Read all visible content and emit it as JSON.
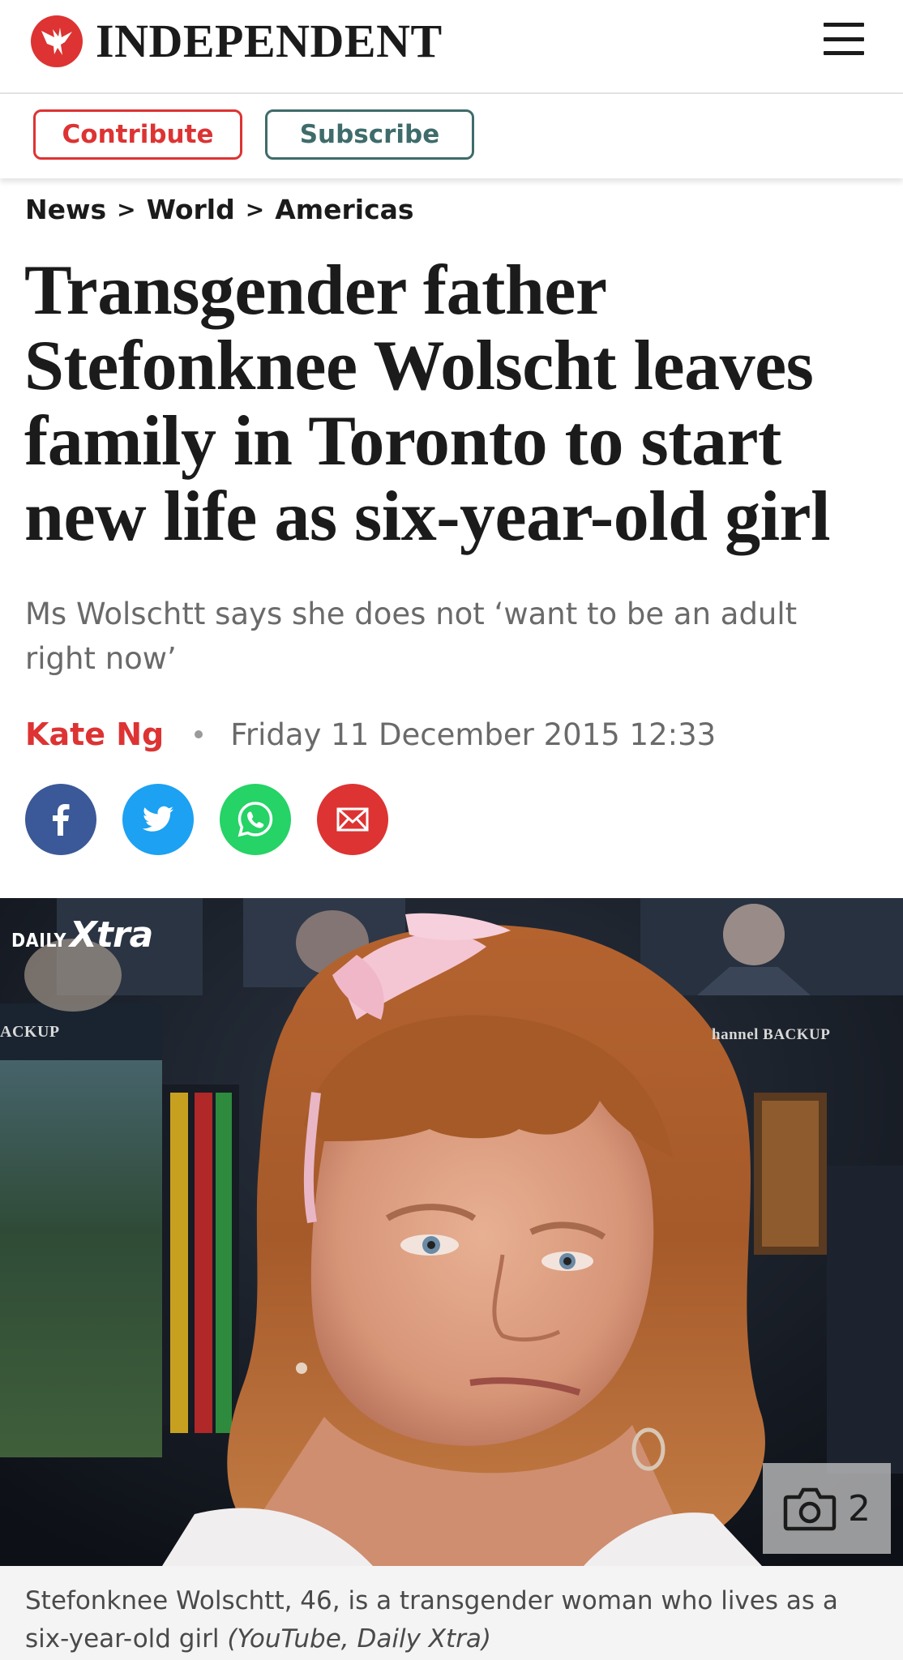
{
  "header": {
    "logo_text": "INDEPENDENT",
    "logo_icon": "eagle-icon",
    "menu_icon": "hamburger-menu-icon"
  },
  "actions": {
    "contribute_label": "Contribute",
    "subscribe_label": "Subscribe"
  },
  "breadcrumb": {
    "items": [
      "News",
      "World",
      "Americas"
    ],
    "separator": ">"
  },
  "article": {
    "headline": "Transgender father Stefonknee Wolscht leaves family in Toronto to start new life as six-year-old girl",
    "standfirst": "Ms Wolschtt says she does not ‘want to be an adult right now’",
    "author": "Kate Ng",
    "date": "Friday 11 December 2015 12:33"
  },
  "share": [
    {
      "icon": "facebook-icon",
      "color": "#3b5998"
    },
    {
      "icon": "twitter-icon",
      "color": "#1da1f2"
    },
    {
      "icon": "whatsapp-icon",
      "color": "#25d366"
    },
    {
      "icon": "email-icon",
      "color": "#dd3333"
    }
  ],
  "image": {
    "watermark_daily": "DAILY",
    "watermark_xtra": "Xtra",
    "screen_text_left": "ACKUP",
    "screen_text_right": "hannel BACKUP",
    "gallery_icon": "camera-icon",
    "gallery_count": "2",
    "caption": "Stefonknee Wolschtt, 46, is a transgender woman who lives as a six-year-old girl",
    "credit": "(YouTube, Daily Xtra)"
  },
  "colors": {
    "brand_red": "#dd3333",
    "subscribe_teal": "#3f6b6b",
    "text_dark": "#1b1b1b",
    "text_grey": "#6a6a6a"
  }
}
